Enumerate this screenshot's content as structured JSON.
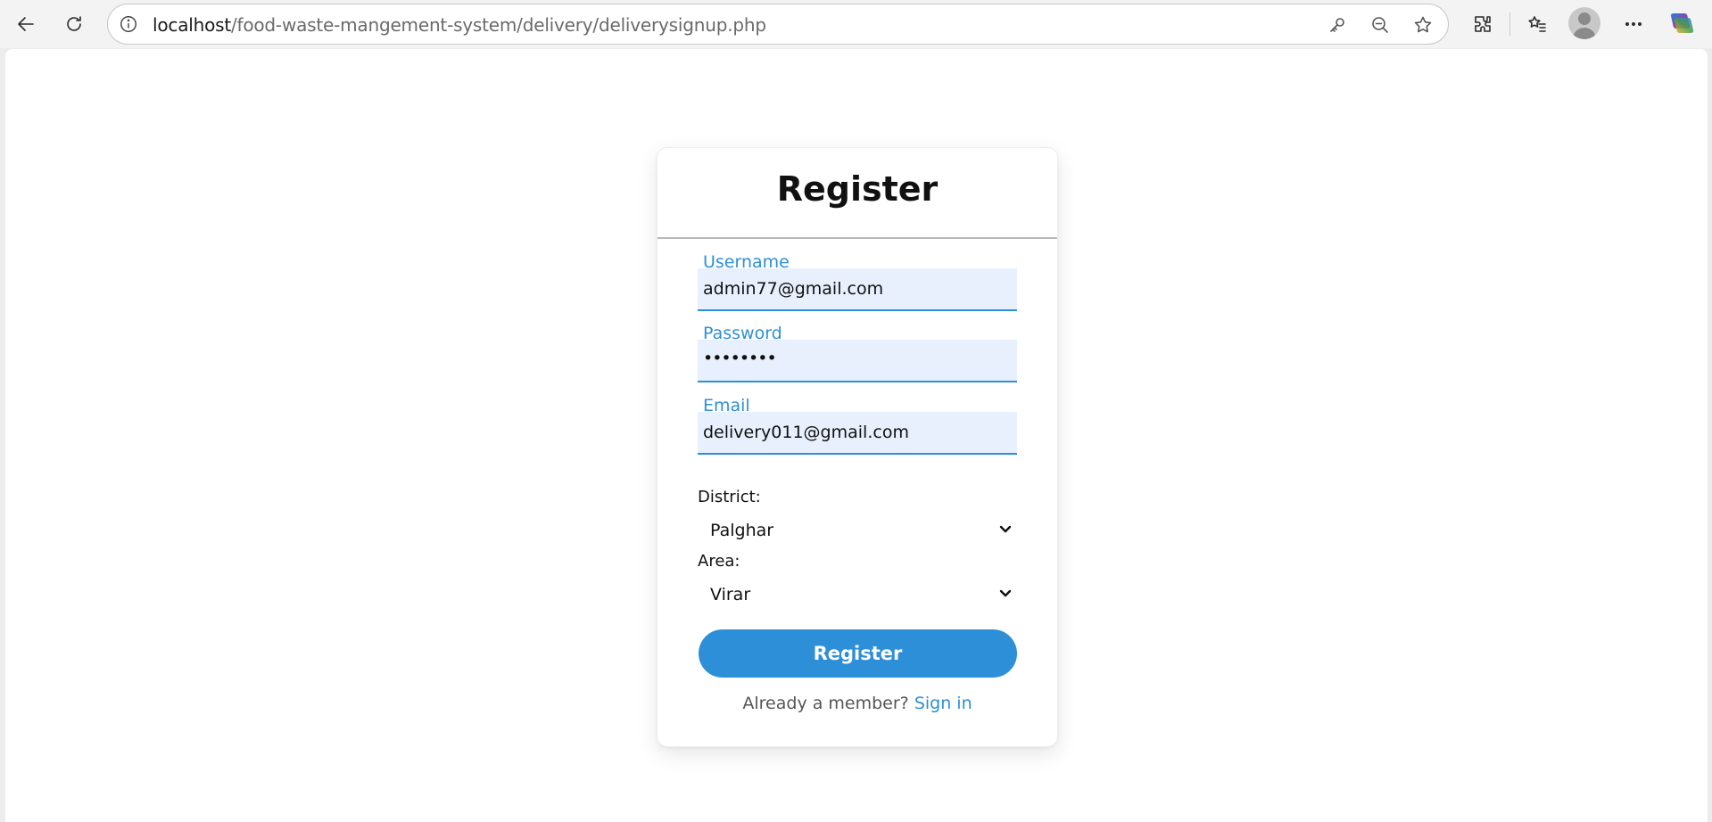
{
  "browser": {
    "url_host": "localhost",
    "url_path": "/food-waste-mangement-system/delivery/deliverysignup.php",
    "icons": [
      "back-icon",
      "refresh-icon",
      "info-icon",
      "key-icon",
      "zoom-out-icon",
      "star-icon",
      "extensions-icon",
      "favorites-icon",
      "avatar",
      "more-icon",
      "copilot-icon"
    ]
  },
  "form": {
    "title": "Register",
    "username": {
      "label": "Username",
      "value": "admin77@gmail.com"
    },
    "password": {
      "label": "Password",
      "value": "••••••••"
    },
    "email": {
      "label": "Email",
      "value": "delivery011@gmail.com"
    },
    "district": {
      "label": "District:",
      "value": "Palghar"
    },
    "area": {
      "label": "Area:",
      "value": "Virar"
    },
    "submit_label": "Register",
    "signin_prompt": "Already a member?",
    "signin_link": "Sign in"
  },
  "colors": {
    "accent": "#2d8fd8",
    "input_bg": "#e8f0fe"
  }
}
